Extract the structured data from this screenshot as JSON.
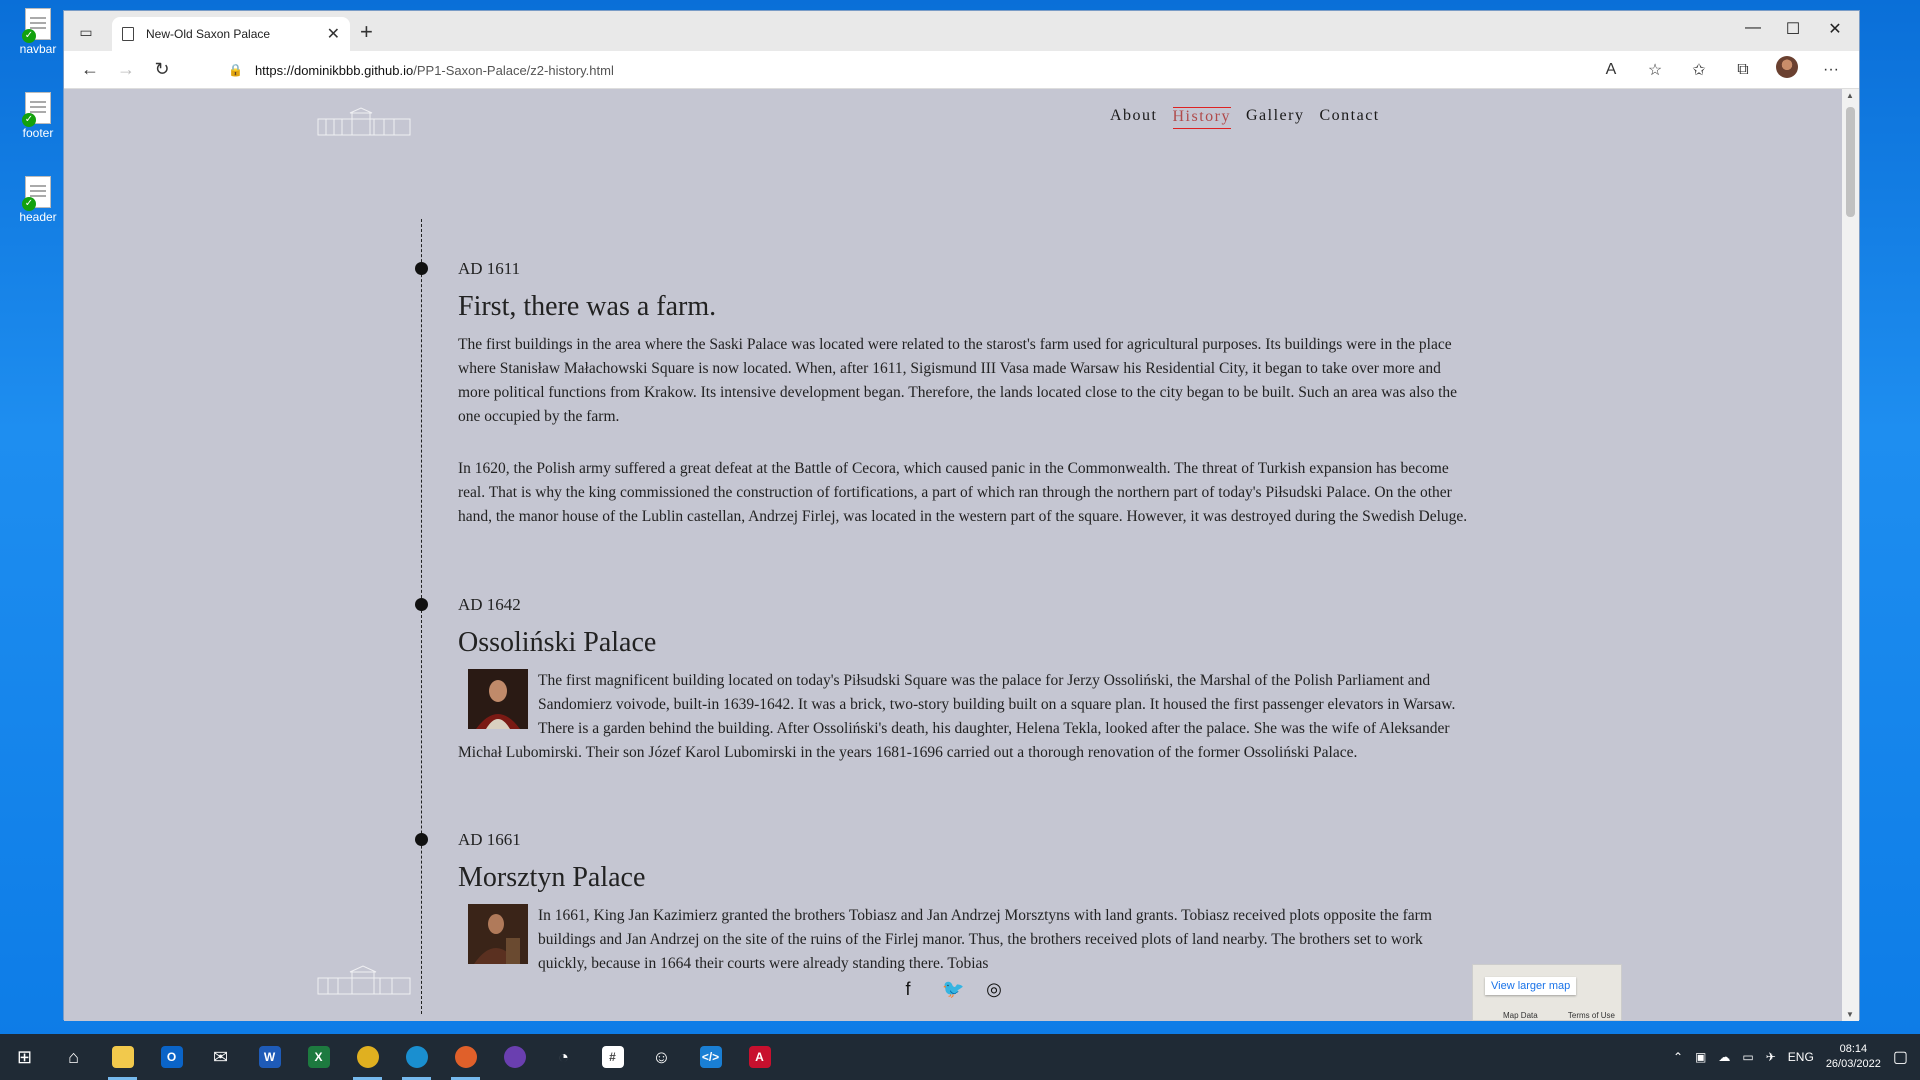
{
  "desktop": {
    "icons": [
      {
        "label": "navbar"
      },
      {
        "label": "footer"
      },
      {
        "label": "header"
      }
    ]
  },
  "browser": {
    "tab_title": "New-Old Saxon Palace",
    "url_host": "https://dominikbbb.github.io",
    "url_path": "/PP1-Saxon-Palace/z2-history.html"
  },
  "site": {
    "nav": [
      "About",
      "History",
      "Gallery",
      "Contact"
    ],
    "active_nav": "History",
    "entries": [
      {
        "year": "AD 1611",
        "title": "First, there was a farm.",
        "paragraphs": [
          "The first buildings in the area where the Saski Palace was located were related to the starost's farm used for agricultural purposes. Its buildings were in the place where Stanisław Małachowski Square is now located. When, after 1611, Sigismund III Vasa made Warsaw his Residential City, it began to take over more and more political functions from Krakow. Its intensive development began. Therefore, the lands located close to the city began to be built. Such an area was also the one occupied by the farm.",
          "In 1620, the Polish army suffered a great defeat at the Battle of Cecora, which caused panic in the Commonwealth. The threat of Turkish expansion has become real. That is why the king commissioned the construction of fortifications, a part of which ran through the northern part of today's Piłsudski Palace. On the other hand, the manor house of the Lublin castellan, Andrzej Firlej, was located in the western part of the square. However, it was destroyed during the Swedish Deluge."
        ]
      },
      {
        "year": "AD 1642",
        "title": "Ossoliński Palace",
        "paragraphs": [
          "The first magnificent building located on today's Piłsudski Square was the palace for Jerzy Ossoliński, the Marshal of the Polish Parliament and Sandomierz voivode, built-in 1639-1642. It was a brick, two-story building built on a square plan. It housed the first passenger elevators in Warsaw. There is a garden behind the building. After Ossoliński's death, his daughter, Helena Tekla, looked after the palace. She was the wife of Aleksander Michał Lubomirski. Their son Józef Karol Lubomirski in the years 1681-1696 carried out a thorough renovation of the former Ossoliński Palace."
        ]
      },
      {
        "year": "AD 1661",
        "title": "Morsztyn Palace",
        "paragraphs": [
          "In 1661, King Jan Kazimierz granted the brothers Tobiasz and Jan Andrzej Morsztyns with land grants. Tobiasz received plots opposite the farm buildings and Jan Andrzej on the site of the ruins of the Firlej manor. Thus, the brothers received plots of land nearby. The brothers set to work quickly, because in 1664 their courts were already standing there. Tobias"
        ]
      }
    ],
    "map": {
      "link_text": "View larger map",
      "map_data": "Map Data",
      "terms": "Terms of Use"
    }
  },
  "taskbar": {
    "tray_lang": "ENG",
    "time": "08:14",
    "date": "26/03/2022"
  },
  "colors": {
    "page_bg": "#c5c6d2",
    "nav_active": "#b04a4a",
    "taskbar": "#1f2a35"
  }
}
